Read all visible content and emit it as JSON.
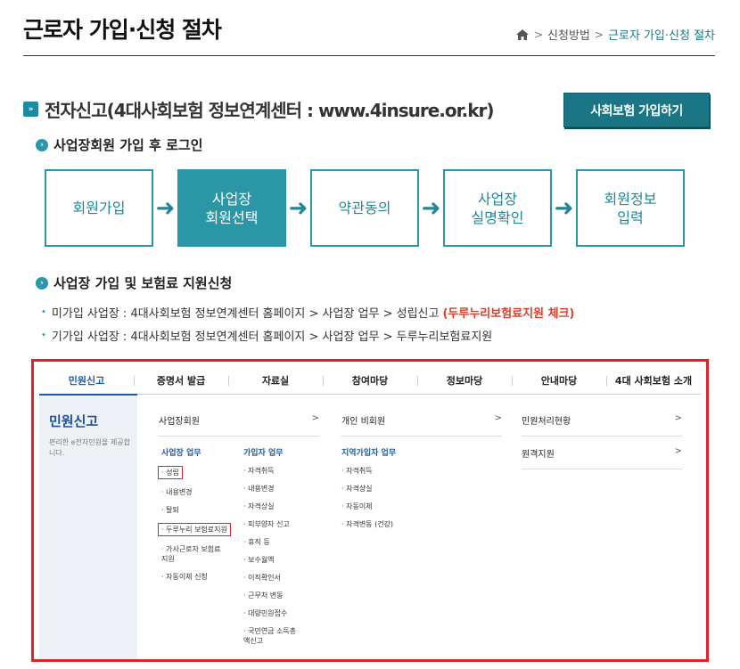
{
  "header": {
    "title": "근로자 가입·신청 절차",
    "breadcrumb": [
      "신청방법",
      "근로자 가입·신청 절차"
    ]
  },
  "section": {
    "heading": "전자신고(4대사회보험 정보연계센터 : www.4insure.or.kr)",
    "join_button": "사회보험 가입하기"
  },
  "login": {
    "heading": "사업장회원 가입 후 로그인",
    "steps": [
      {
        "line1": "회원가입",
        "line2": ""
      },
      {
        "line1": "사업장",
        "line2": "회원선택"
      },
      {
        "line1": "약관동의",
        "line2": ""
      },
      {
        "line1": "사업장",
        "line2": "실명확인"
      },
      {
        "line1": "회원정보",
        "line2": "입력"
      }
    ]
  },
  "apply": {
    "heading": "사업장 가입 및 보험료 지원신청",
    "line1_text": "미가입 사업장 : 4대사회보험 정보연계센터 홈페이지 > 사업장 업무 > 성립신고",
    "line1_highlight": "(두루누리보험료지원 체크)",
    "line2_text": "기가입 사업장 : 4대사회보험 정보연계센터 홈페이지 > 사업장 업무 > 두루누리보험료지원"
  },
  "screenshot": {
    "nav": [
      "민원신고",
      "증명서 발급",
      "자료실",
      "참여마당",
      "정보마당",
      "안내마당",
      "4대 사회보험 소개"
    ],
    "left_title": "민원신고",
    "left_desc": "편리한 e전자민원을 제공합니다.",
    "rows": [
      "사업장회원",
      "개인 비회원",
      "민원처리현황",
      "원격지원"
    ],
    "chevron": ">",
    "col1_head": "사업장 업무",
    "col1": [
      "성립",
      "내용변경",
      "탈퇴",
      "두루누리 보험료지원",
      "가사근로자 보험료지원",
      "자동이체 신청"
    ],
    "col2_head": "가입자 업무",
    "col2": [
      "자격취득",
      "내용변경",
      "자격상실",
      "피부양자 신고",
      "휴직 등",
      "보수월액",
      "이직확인서",
      "근무처 변동",
      "대량민원접수",
      "국민연금 소득총액신고"
    ],
    "col3_head": "지역가입자 업무",
    "col3": [
      "자격취득",
      "자격상실",
      "자동이체",
      "자격변동 (건강)"
    ]
  }
}
